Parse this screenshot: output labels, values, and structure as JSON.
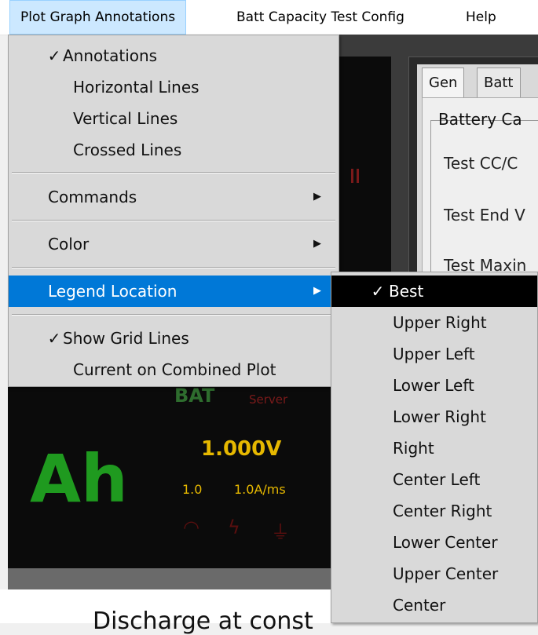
{
  "menubar": [
    {
      "label": "Plot Graph Annotations",
      "active": true
    },
    {
      "label": "Batt Capacity Test Config",
      "active": false
    },
    {
      "label": "Help",
      "active": false
    }
  ],
  "menu": {
    "annotations": "Annotations",
    "horizontal_lines": "Horizontal Lines",
    "vertical_lines": "Vertical Lines",
    "crossed_lines": "Crossed Lines",
    "commands": "Commands",
    "color": "Color",
    "legend_location": "Legend Location",
    "show_grid_lines": "Show Grid Lines",
    "current_on_combined_plot": "Current on Combined Plot",
    "check_glyph": "✓",
    "submenu_arrow": "▶"
  },
  "legend_submenu": {
    "items": [
      "Best",
      "Upper Right",
      "Upper Left",
      "Lower Left",
      "Lower Right",
      "Right",
      "Center Left",
      "Center Right",
      "Lower Center",
      "Upper Center",
      "Center"
    ],
    "selected": "Best"
  },
  "config_panel": {
    "tabs": [
      "Gen",
      "Batt"
    ],
    "group_title": "Battery Ca",
    "labels": [
      "Test CC/C",
      "Test End V",
      "Test Maxin"
    ]
  },
  "instrument": {
    "bat_label": "BAT",
    "server_label": "Server",
    "unit_big": "Ah",
    "voltage": "1.000V",
    "value_a": "1.0",
    "value_b": "1.0A/ms"
  },
  "caption": "Discharge at const",
  "colors": {
    "highlight": "#0078d7",
    "menu_bg": "#d9d9d9",
    "submenu_selected_bg": "#000000",
    "ah_green": "#1f9a1f",
    "readout_yellow": "#e6b800"
  }
}
